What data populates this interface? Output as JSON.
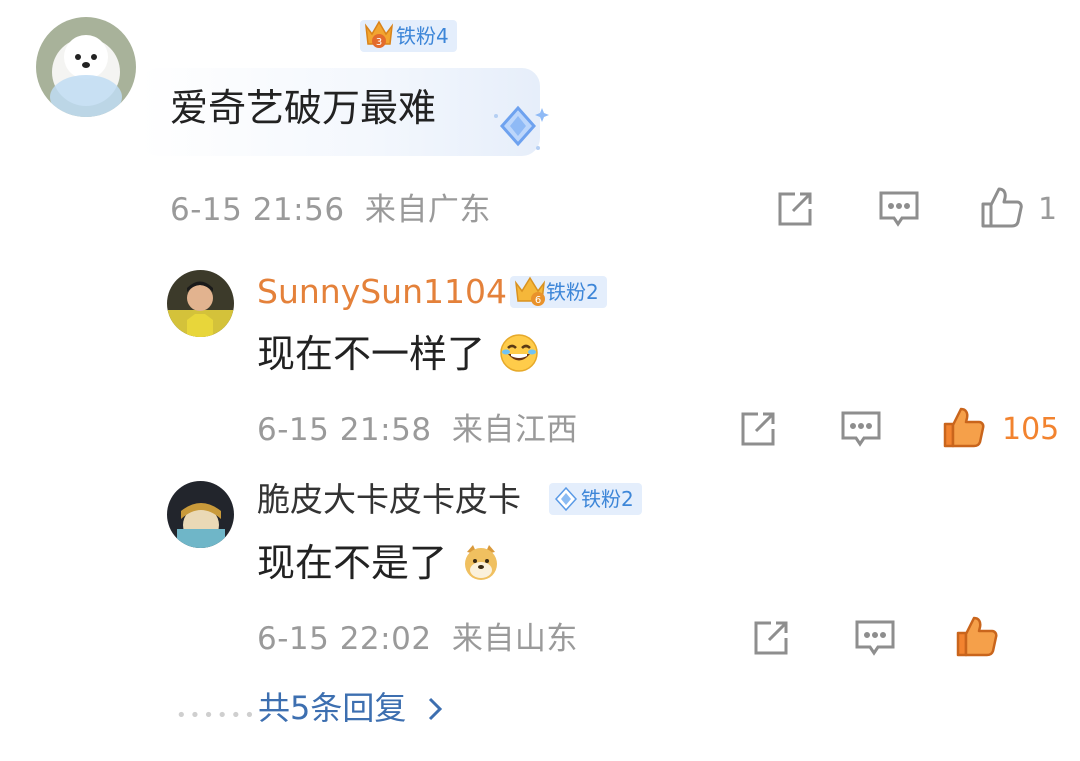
{
  "comments": [
    {
      "badge": "铁粉4",
      "text": "爱奇艺破万最难",
      "time": "6-15 21:56",
      "location": "来自广东",
      "likes": "1",
      "liked": false
    },
    {
      "username": "SunnySun1104",
      "badge": "铁粉2",
      "text": "现在不一样了",
      "time": "6-15 21:58",
      "location": "来自江西",
      "likes": "105",
      "liked": true
    },
    {
      "username": "脆皮大卡皮卡皮卡",
      "badge": "铁粉2",
      "text": "现在不是了",
      "time": "6-15 22:02",
      "location": "来自山东",
      "likes": "",
      "liked": true
    }
  ],
  "more_replies": "共5条回复",
  "icons": {
    "share": "share-icon",
    "comment": "comment-icon",
    "like": "thumbs-up-icon",
    "chevron": "chevron-right-icon",
    "emoji_laugh": "laughing-emoji-icon",
    "emoji_doge": "doge-emoji-icon"
  },
  "colors": {
    "username_orange": "#e4813a",
    "username_dark": "#333333",
    "link_blue": "#3d6fb0",
    "liked_orange": "#f2832f",
    "badge_bg": "#e4eefc",
    "badge_text": "#3d86d8",
    "meta_gray": "#9a9a9a"
  }
}
